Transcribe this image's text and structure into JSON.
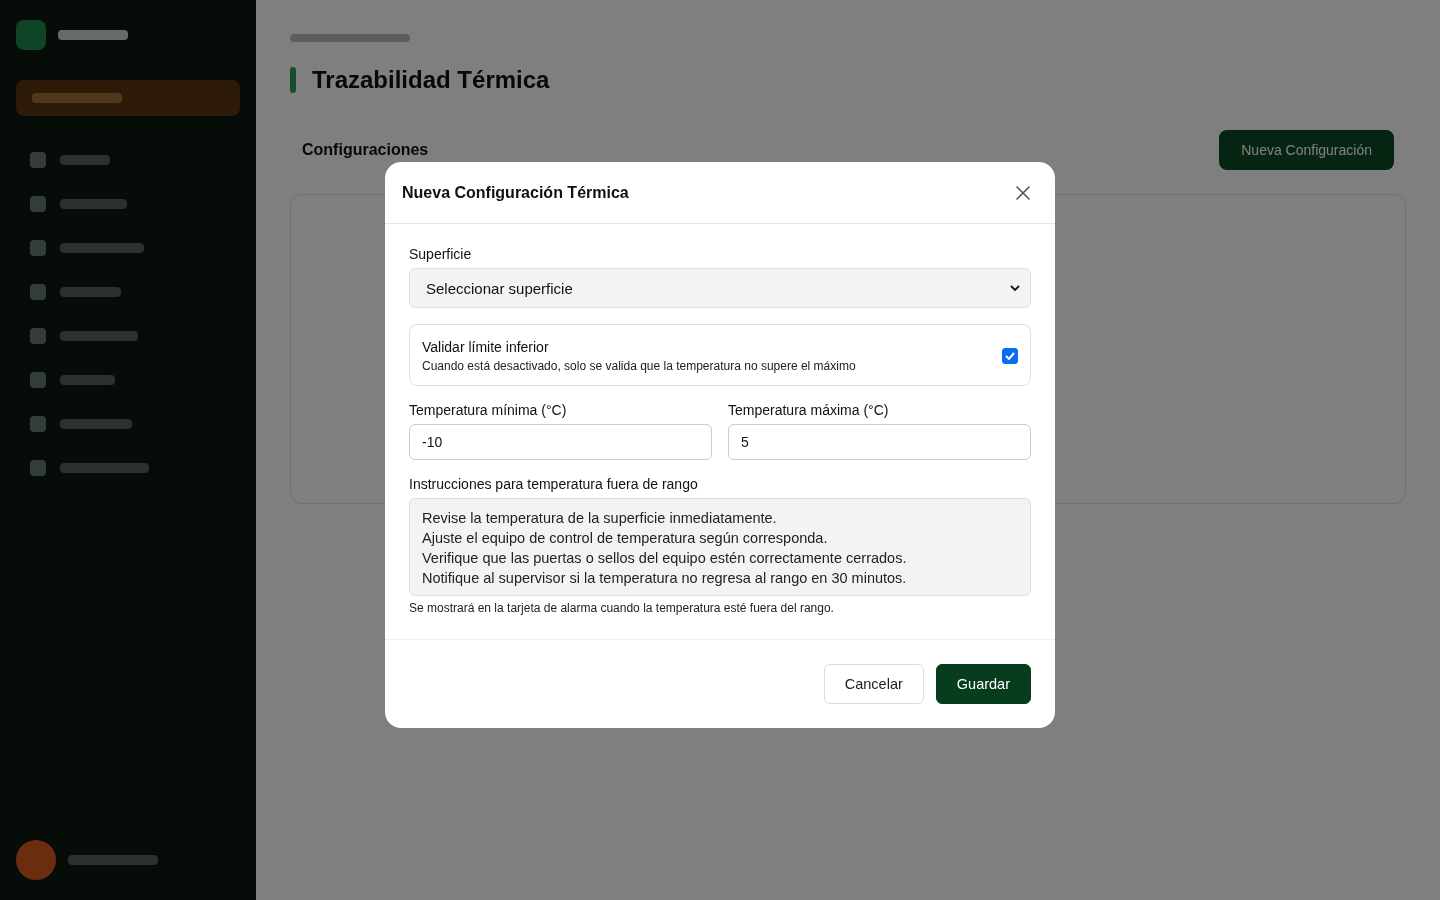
{
  "page": {
    "title": "Trazabilidad Térmica",
    "section_title": "Configuraciones",
    "new_button": "Nueva Configuración"
  },
  "modal": {
    "title": "Nueva Configuración Térmica",
    "surface": {
      "label": "Superficie",
      "value": "Seleccionar superficie"
    },
    "validate_lower": {
      "title": "Validar límite inferior",
      "description": "Cuando está desactivado, solo se valida que la temperatura no supere el máximo",
      "checked": true
    },
    "min_temp": {
      "label": "Temperatura mínima (°C)",
      "value": "-10"
    },
    "max_temp": {
      "label": "Temperatura máxima (°C)",
      "value": "5"
    },
    "instructions": {
      "label": "Instrucciones para temperatura fuera de rango",
      "value": "Revise la temperatura de la superficie inmediatamente.\nAjuste el equipo de control de temperatura según corresponda.\nVerifique que las puertas o sellos del equipo estén correctamente cerrados.\nNotifique al supervisor si la temperatura no regresa al rango en 30 minutos.",
      "help": "Se mostrará en la tarjeta de alarma cuando la temperatura esté fuera del rango."
    },
    "buttons": [
      {
        "label": "Cancelar",
        "kind": "secondary"
      },
      {
        "label": "Guardar",
        "kind": "primary"
      }
    ]
  }
}
